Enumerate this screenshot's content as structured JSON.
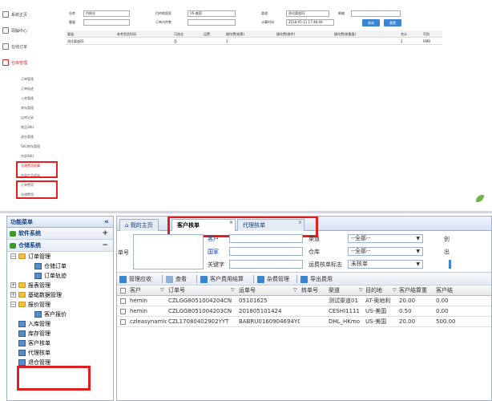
{
  "top": {
    "nav": [
      {
        "label": "系统主页"
      },
      {
        "label": "頭脳中心"
      },
      {
        "label": "在线订单"
      },
      {
        "label": "仓库管理"
      }
    ],
    "sub": [
      "订单管理",
      "订单轨迹",
      "入库管理",
      "库存管理",
      "出库记录",
      "商品SKU",
      "退仓管理",
      "SKU库存管理",
      "外部SKU",
      "仓储费用结算",
      "外部产品成本",
      "订单费用",
      "仓储费用"
    ],
    "form": {
      "warehouse_label": "仓库",
      "warehouse_value": "约格仓",
      "dest_label": "目的地国家",
      "dest_value": "US-美国",
      "channel_label": "渠道",
      "channel_value": "测试渠道01",
      "weight_label": "重量",
      "order_label": "订单内件数",
      "calc_time_label": "计算时间",
      "calc_time_value": "2018-05-11 17:48:48",
      "new_label": "邮编",
      "query_btn": "查询",
      "reset_btn": "重置"
    },
    "grid": {
      "headers": [
        "渠道",
        "参考到货时间",
        "可选仓",
        "运费",
        "操作费(按票)",
        "操作费(按件)",
        "操作费(按重量)",
        "合计",
        "币别"
      ],
      "row": [
        "测试渠道01",
        "",
        "否",
        "",
        "2",
        "",
        "",
        "2",
        "RMB"
      ]
    }
  },
  "sidebar": {
    "title": "功能菜单",
    "collapse": "«",
    "sections": [
      {
        "label": "软件系统",
        "toggle": "+"
      },
      {
        "label": "仓储系统",
        "toggle": "−"
      }
    ],
    "tree": [
      {
        "label": "订单管理",
        "type": "folder",
        "toggle": "−",
        "level": 1
      },
      {
        "label": "仓储订单",
        "type": "page",
        "level": 3
      },
      {
        "label": "订单轨迹",
        "type": "page",
        "level": 3
      },
      {
        "label": "报表管理",
        "type": "folder",
        "toggle": "+",
        "level": 1
      },
      {
        "label": "基础数据管理",
        "type": "folder",
        "toggle": "+",
        "level": 1
      },
      {
        "label": "报价管理",
        "type": "folder",
        "toggle": "−",
        "level": 1
      },
      {
        "label": "客户报价",
        "type": "page",
        "level": 3
      },
      {
        "label": "入库管理",
        "type": "page",
        "level": 2
      },
      {
        "label": "库存管理",
        "type": "page",
        "level": 2
      },
      {
        "label": "客户核单",
        "type": "page",
        "level": 2
      },
      {
        "label": "代理核单",
        "type": "page",
        "level": 2
      },
      {
        "label": "退仓管理",
        "type": "page",
        "level": 2
      }
    ]
  },
  "tabs": [
    {
      "label": "我的主页",
      "icon": "home-icon"
    },
    {
      "label": "客户核单",
      "close": "×",
      "active": true
    },
    {
      "label": "代理核单",
      "close": "×"
    }
  ],
  "form": {
    "single_label": "单号",
    "customer_label": "客户",
    "country_label": "国家",
    "keyword_label": "关键字",
    "channel_label": "渠道",
    "channel_value": "--全部--",
    "warehouse_label": "仓库",
    "warehouse_value": "--全部--",
    "fee_flag_label": "运费核单标志",
    "fee_flag_value": "未核单",
    "cut1": "创",
    "cut2": "出"
  },
  "toolbar": {
    "manage_fee": "管理应收",
    "view": "查看",
    "customer_settle": "客户费用结算",
    "misc_fee": "杂费管理",
    "export_fee": "导出费用"
  },
  "grid": {
    "headers": [
      "客户",
      "订单号",
      "运单号",
      "转单号",
      "渠道",
      "目的地",
      "客户结算重",
      "客户结"
    ],
    "rows": [
      [
        "hemin",
        "CZLGG8051004204CN",
        "05101625",
        "",
        "测试渠道01",
        "AT-奥地利",
        "20.00",
        "0.00"
      ],
      [
        "hemin",
        "CZLGG8051004203CN",
        "201805101424",
        "",
        "CESHI1111",
        "US-美国",
        "0.50",
        "0.00"
      ],
      [
        "czleasynamic",
        "CZL17080402902YYT",
        "BABRU0160904694YQ",
        "",
        "DHL_HKmo",
        "US-美国",
        "20.00",
        "500.00"
      ]
    ]
  }
}
